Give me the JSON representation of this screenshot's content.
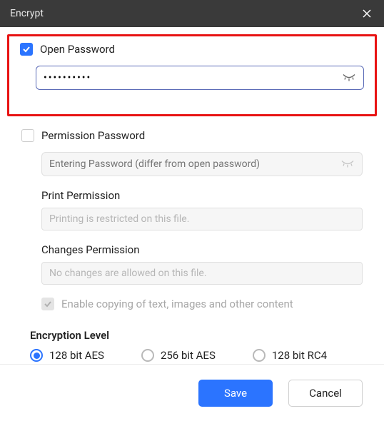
{
  "titlebar": {
    "title": "Encrypt"
  },
  "openPassword": {
    "label": "Open Password",
    "value": "••••••••••"
  },
  "permPassword": {
    "label": "Permission Password",
    "placeholder": "Entering Password (differ from open password)"
  },
  "printPermission": {
    "label": "Print Permission",
    "value": "Printing is restricted on this file."
  },
  "changesPermission": {
    "label": "Changes Permission",
    "value": "No changes are allowed on this file."
  },
  "copyOption": {
    "label": "Enable copying of text, images and other content"
  },
  "encryption": {
    "label": "Encryption Level",
    "options": [
      "128 bit AES",
      "256 bit AES",
      "128 bit RC4"
    ]
  },
  "footer": {
    "save": "Save",
    "cancel": "Cancel"
  }
}
